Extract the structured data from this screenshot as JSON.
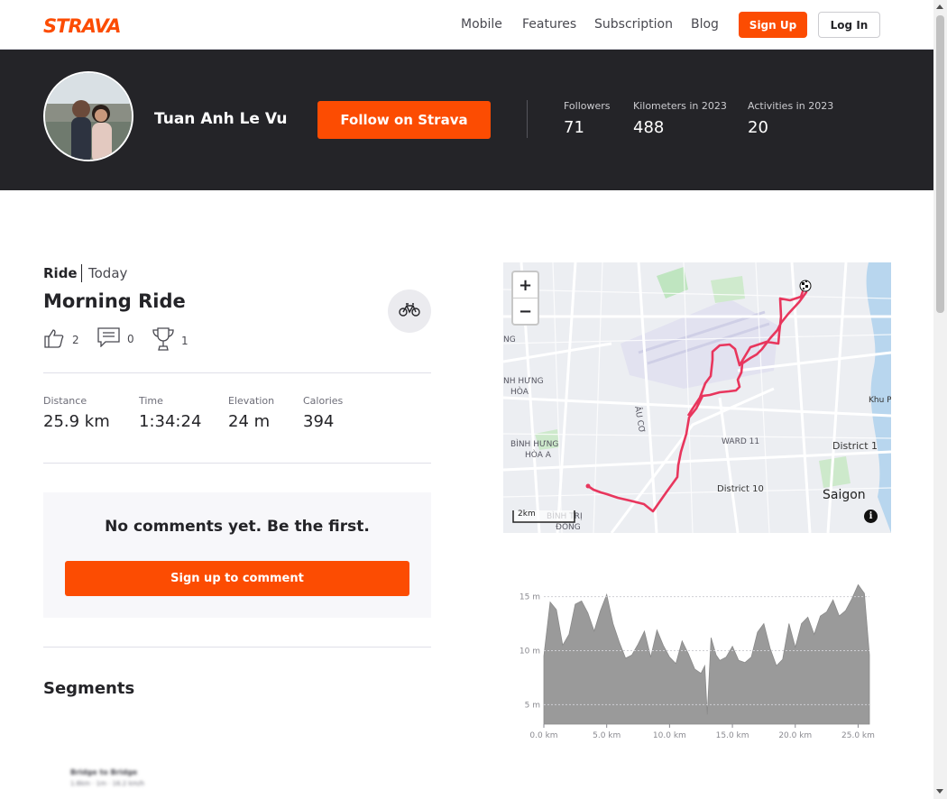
{
  "nav": {
    "logo": "STRAVA",
    "links": [
      "Mobile",
      "Features",
      "Subscription",
      "Blog"
    ],
    "signup": "Sign Up",
    "login": "Log In"
  },
  "athlete": {
    "name": "Tuan Anh Le Vu",
    "follow_label": "Follow on Strava",
    "stats": [
      {
        "label": "Followers",
        "value": "71"
      },
      {
        "label": "Kilometers in 2023",
        "value": "488"
      },
      {
        "label": "Activities in 2023",
        "value": "20"
      }
    ]
  },
  "activity": {
    "type": "Ride",
    "date": "Today",
    "title": "Morning Ride",
    "kudos": "2",
    "comments": "0",
    "achievements": "1",
    "metrics": [
      {
        "label": "Distance",
        "value": "25.9 km"
      },
      {
        "label": "Time",
        "value": "1:34:24"
      },
      {
        "label": "Elevation",
        "value": "24 m"
      },
      {
        "label": "Calories",
        "value": "394"
      }
    ]
  },
  "comments": {
    "empty_text": "No comments yet. Be the first.",
    "signup_label": "Sign up to comment"
  },
  "segments": {
    "heading": "Segments",
    "first": {
      "name": "Bridge to Bridge",
      "stats": "1.6km · 1m · 16.2 km/h"
    }
  },
  "map": {
    "zoom_in": "+",
    "zoom_out": "−",
    "scale": "2km",
    "labels": [
      "Khu P",
      "District 1",
      "Saigon",
      "District 10",
      "WARD 11",
      "ÂU CƠ",
      "BÌNH HƯNG HÒA A",
      "NH HƯNG HÒA",
      "BÌNH TRỊ ĐÔNG",
      "NG"
    ],
    "route_color": "#e8365d"
  },
  "chart_data": {
    "type": "area",
    "xlabel": "",
    "ylabel": "",
    "x_ticks": [
      "0.0 km",
      "5.0 km",
      "10.0 km",
      "15.0 km",
      "20.0 km",
      "25.0 km"
    ],
    "y_ticks": [
      "15 m",
      "10 m",
      "5 m"
    ],
    "xlim": [
      0,
      25.9
    ],
    "ylim": [
      3.2,
      16.8
    ],
    "x": [
      0,
      0.5,
      1,
      1.5,
      2,
      2.5,
      3,
      3.5,
      4,
      4.5,
      5,
      5.5,
      6,
      6.5,
      7,
      7.5,
      8,
      8.5,
      9,
      9.5,
      10,
      10.5,
      11,
      11.5,
      12,
      12.5,
      12.8,
      13,
      13.3,
      13.7,
      14,
      14.5,
      15,
      15.5,
      16,
      16.5,
      17,
      17.5,
      18,
      18.5,
      19,
      19.5,
      20,
      20.5,
      21,
      21.5,
      22,
      22.5,
      23,
      23.5,
      24,
      24.5,
      25,
      25.5,
      25.9
    ],
    "y": [
      9.5,
      14.5,
      13.8,
      10.5,
      11.5,
      14.3,
      14.6,
      13.5,
      11.8,
      13.7,
      15.2,
      12.5,
      10.8,
      9.3,
      9.6,
      10.6,
      11.8,
      9.4,
      11.9,
      10.5,
      9.4,
      8.8,
      10.9,
      9.7,
      8.3,
      7.9,
      8.6,
      4.1,
      11.2,
      9.6,
      9.1,
      9.4,
      10.4,
      9.1,
      8.9,
      9.4,
      11.7,
      12.5,
      10.2,
      8.6,
      9.2,
      12.5,
      10.3,
      12.5,
      13.1,
      11.5,
      13.2,
      13.6,
      14.7,
      13.2,
      13.7,
      14.8,
      16.1,
      15.3,
      9.6
    ],
    "fill_color": "#9a9a9a",
    "grid": true
  },
  "colors": {
    "brand": "#fc4c02",
    "banner": "#242428"
  }
}
